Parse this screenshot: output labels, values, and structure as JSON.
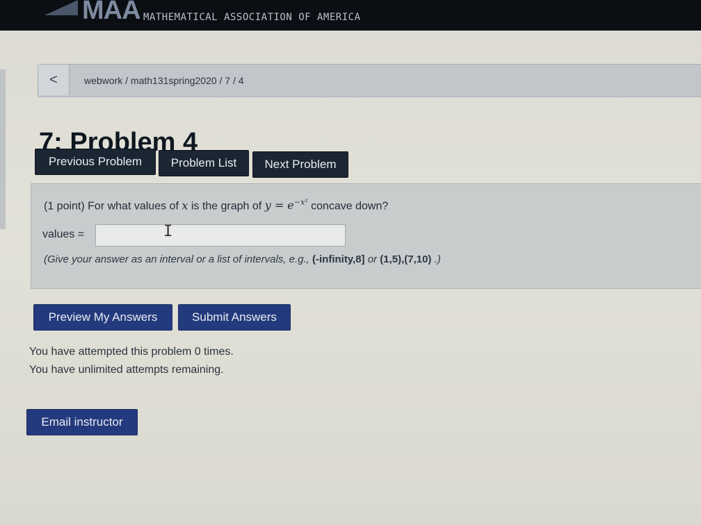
{
  "header": {
    "logo_text": "MAA",
    "org_name": "MATHEMATICAL ASSOCIATION OF AMERICA"
  },
  "breadcrumb": {
    "back_label": "<",
    "path": "webwork / math131spring2020 / 7 / 4"
  },
  "page_title": "7: Problem 4",
  "nav_buttons": {
    "previous": "Previous Problem",
    "list": "Problem List",
    "next": "Next Problem"
  },
  "problem": {
    "points": "(1 point)",
    "question_start": "For what values of",
    "question_var": "x",
    "question_mid": "is the graph of",
    "question_eq_lhs": "y = e",
    "question_exp": "−x²",
    "question_end": "concave down?",
    "answer_label": "values =",
    "answer_value": "",
    "hint_start": "(Give your answer as an interval or a list of intervals, e.g.,",
    "hint_example1": "(-infinity,8]",
    "hint_or": "or",
    "hint_example2": "(1,5),(7,10)",
    "hint_end": ".)"
  },
  "submit_buttons": {
    "preview": "Preview My Answers",
    "submit": "Submit Answers"
  },
  "status": {
    "attempts": "You have attempted this problem 0 times.",
    "remaining": "You have unlimited attempts remaining."
  },
  "email_button": "Email instructor",
  "colors": {
    "header_bg": "#0b0e12",
    "nav_button_bg": "#1b2633",
    "submit_button_bg": "#243a7e",
    "problem_box_bg": "#c9cccd"
  }
}
